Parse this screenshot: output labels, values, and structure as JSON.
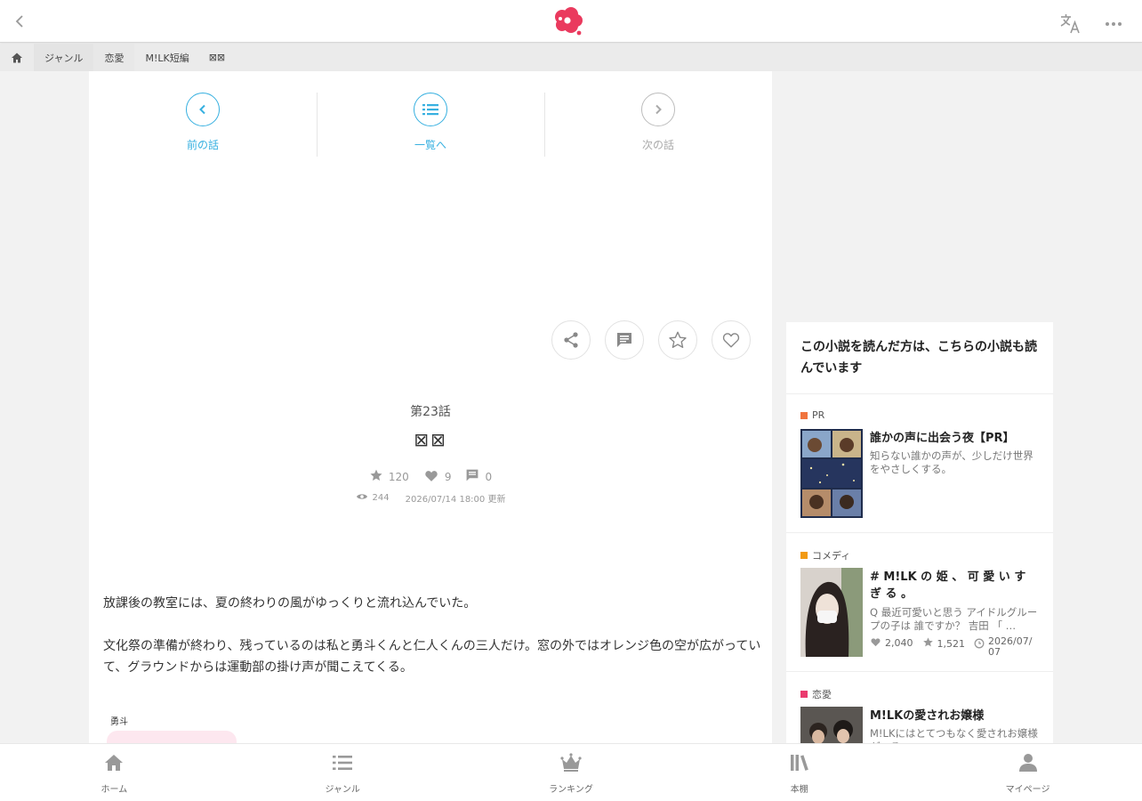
{
  "header": {
    "back_icon": "chevron-left-icon",
    "logo_icon": "milk-logo-icon",
    "translate_icon": "translate-icon",
    "more_icon": "more-horizontal-icon",
    "brand_color": "#ea3a5e"
  },
  "breadcrumb": {
    "home_icon": "home-icon",
    "items": [
      "ジャンル",
      "恋愛",
      "M!LK短編",
      "⊠⊠"
    ]
  },
  "episode_nav": {
    "prev_label": "前の話",
    "list_label": "一覧へ",
    "next_label": "次の話",
    "accent_color": "#37b0e0"
  },
  "actions": {
    "share_icon": "share-icon",
    "comment_icon": "comment-icon",
    "favorite_icon": "star-icon",
    "like_icon": "heart-icon"
  },
  "episode": {
    "number": "第23話",
    "title": "⊠⊠",
    "stars": "120",
    "likes": "9",
    "comments": "0",
    "views": "244",
    "updated": "2026/07/14 18:00 更新"
  },
  "body": {
    "paragraphs": [
      "放課後の教室には、夏の終わりの風がゆっくりと流れ込んでいた。",
      "文化祭の準備が終わり、残っているのは私と勇斗くんと仁人くんの三人だけ。窓の外ではオレンジ色の空が広がっていて、グラウンドからは運動部の掛け声が聞こえてくる。"
    ],
    "speaker": "勇斗",
    "bubble_color": "#fde7ef"
  },
  "sidebar": {
    "heading": "この小説を読んだ方は、こちらの小説も読んでいます",
    "items": [
      {
        "tag": "PR",
        "tag_color": "#f0743e",
        "title": "誰かの声に出会う夜【PR】",
        "desc": "知らない誰かの声が、少しだけ世界をやさしくする。"
      },
      {
        "tag": "コメディ",
        "tag_color": "#f29a13",
        "title": "# M!LK の 姫 、 可 愛 い す ぎ る 。",
        "desc": "Q 最近可愛いと思う アイドルグループの子は 誰ですか？ 吉田 「 …",
        "likes": "2,040",
        "stars": "1,521",
        "date": "2026/07/07"
      },
      {
        "tag": "恋愛",
        "tag_color": "#ea3a6e",
        "title": "M!LKの愛されお嬢様",
        "desc": "M!LKにはとてつもなく愛されお嬢様がいる..."
      }
    ]
  },
  "bottom_nav": {
    "home": "ホーム",
    "genre": "ジャンル",
    "ranking": "ランキング",
    "shelf": "本棚",
    "mypage": "マイページ"
  }
}
